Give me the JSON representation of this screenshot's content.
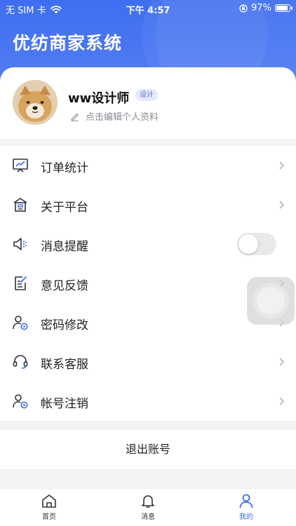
{
  "status_bar": {
    "carrier": "无 SIM 卡",
    "time": "下午 4:57",
    "battery_percent": "97%",
    "battery_level": 0.97
  },
  "app": {
    "title": "优纺商家系统"
  },
  "profile": {
    "username": "ww设计师",
    "role": "设计",
    "edit_hint": "点击编辑个人资料"
  },
  "menu": {
    "items": [
      {
        "label": "订单统计",
        "icon": "chart-board-icon"
      },
      {
        "label": "关于平台",
        "icon": "building-icon"
      },
      {
        "label": "消息提醒",
        "icon": "speaker-icon",
        "toggle": false
      },
      {
        "label": "意见反馈",
        "icon": "feedback-edit-icon"
      },
      {
        "label": "密码修改",
        "icon": "user-settings-icon"
      },
      {
        "label": "联系客服",
        "icon": "headset-icon"
      },
      {
        "label": "帐号注销",
        "icon": "user-settings-icon"
      }
    ]
  },
  "logout_label": "退出账号",
  "tabs": [
    {
      "label": "首页",
      "icon": "home-icon"
    },
    {
      "label": "消息",
      "icon": "bell-icon"
    },
    {
      "label": "我的",
      "icon": "user-icon",
      "active": true
    }
  ],
  "colors": {
    "brand": "#3f6ef0",
    "text": "#222222",
    "muted": "#8a8d93",
    "badge_bg": "#e6e9fb"
  }
}
